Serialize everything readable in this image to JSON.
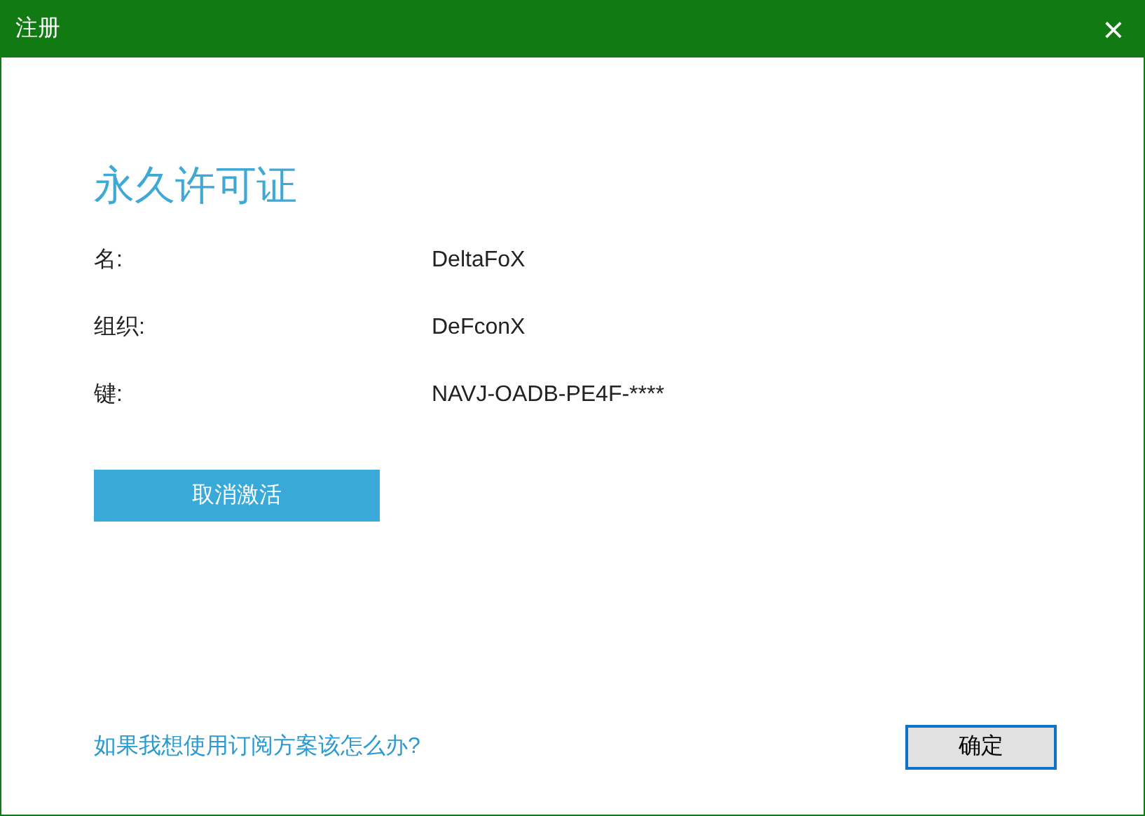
{
  "window": {
    "title": "注册",
    "close": "×"
  },
  "heading": "永久许可证",
  "fields": [
    {
      "label": "名:",
      "value": "DeltaFoX"
    },
    {
      "label": "组织:",
      "value": "DeFconX"
    },
    {
      "label": "键:",
      "value": "NAVJ-OADB-PE4F-****"
    }
  ],
  "deactivate_button": "取消激活",
  "subscription_link": "如果我想使用订阅方案该怎么办?",
  "ok_button": "确定"
}
